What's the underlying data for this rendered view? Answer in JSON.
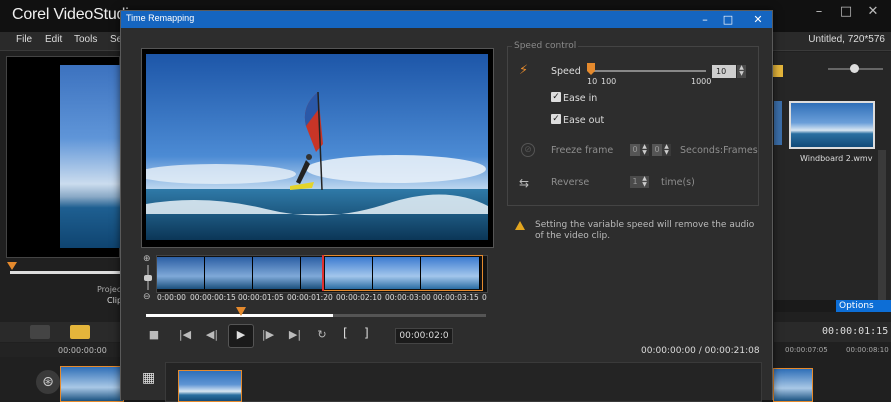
{
  "app": {
    "logo": "Corel VideoStudio",
    "menu": [
      "File",
      "Edit",
      "Tools",
      "Se"
    ],
    "project_title": "Untitled, 720*576",
    "left_project_label": "Projec",
    "left_clip_label": "Clip",
    "timeline_time": "00:00:00:00",
    "library_item_label": "Windboard 2.wmv",
    "options_label": "Options",
    "timeline_timecode": "00:00:01:15",
    "timeline_mark_1": "00:00:07:05",
    "timeline_mark_2": "00:00:08:10"
  },
  "dialog": {
    "title": "Time Remapping",
    "minimize": "–",
    "maximize": "□",
    "close": "✕",
    "timecodes": [
      "0:00:00",
      "00:00:00:15",
      "00:00:01:05",
      "00:00:01:20",
      "00:00:02:10",
      "00:00:03:00",
      "00:00:03:15",
      "0"
    ],
    "playback": {
      "timecode": "00:00:02:0",
      "bracket_in": "[",
      "bracket_out": "]",
      "total_time": "00:00:00:00 / 00:00:21:08",
      "progress": 0.55,
      "marker_position": 0.28
    },
    "speed_control": {
      "title": "Speed control",
      "speed_label": "Speed",
      "speed_min": "10",
      "speed_mid": "100",
      "speed_max": "1000",
      "speed_value": "10",
      "ease_in_label": "Ease in",
      "ease_in_checked": true,
      "ease_out_label": "Ease out",
      "ease_out_checked": true,
      "freeze_label": "Freeze frame",
      "freeze_seconds": "0",
      "freeze_frames": "0",
      "freeze_unit": "Seconds:Frames",
      "reverse_label": "Reverse",
      "reverse_value": "1",
      "reverse_unit": "time(s)"
    },
    "warning": "Setting the variable speed will remove the audio of the video clip."
  },
  "colors": {
    "accent": "#e58a2d",
    "titlebar": "#1565c0",
    "options": "#0d6ed6"
  }
}
